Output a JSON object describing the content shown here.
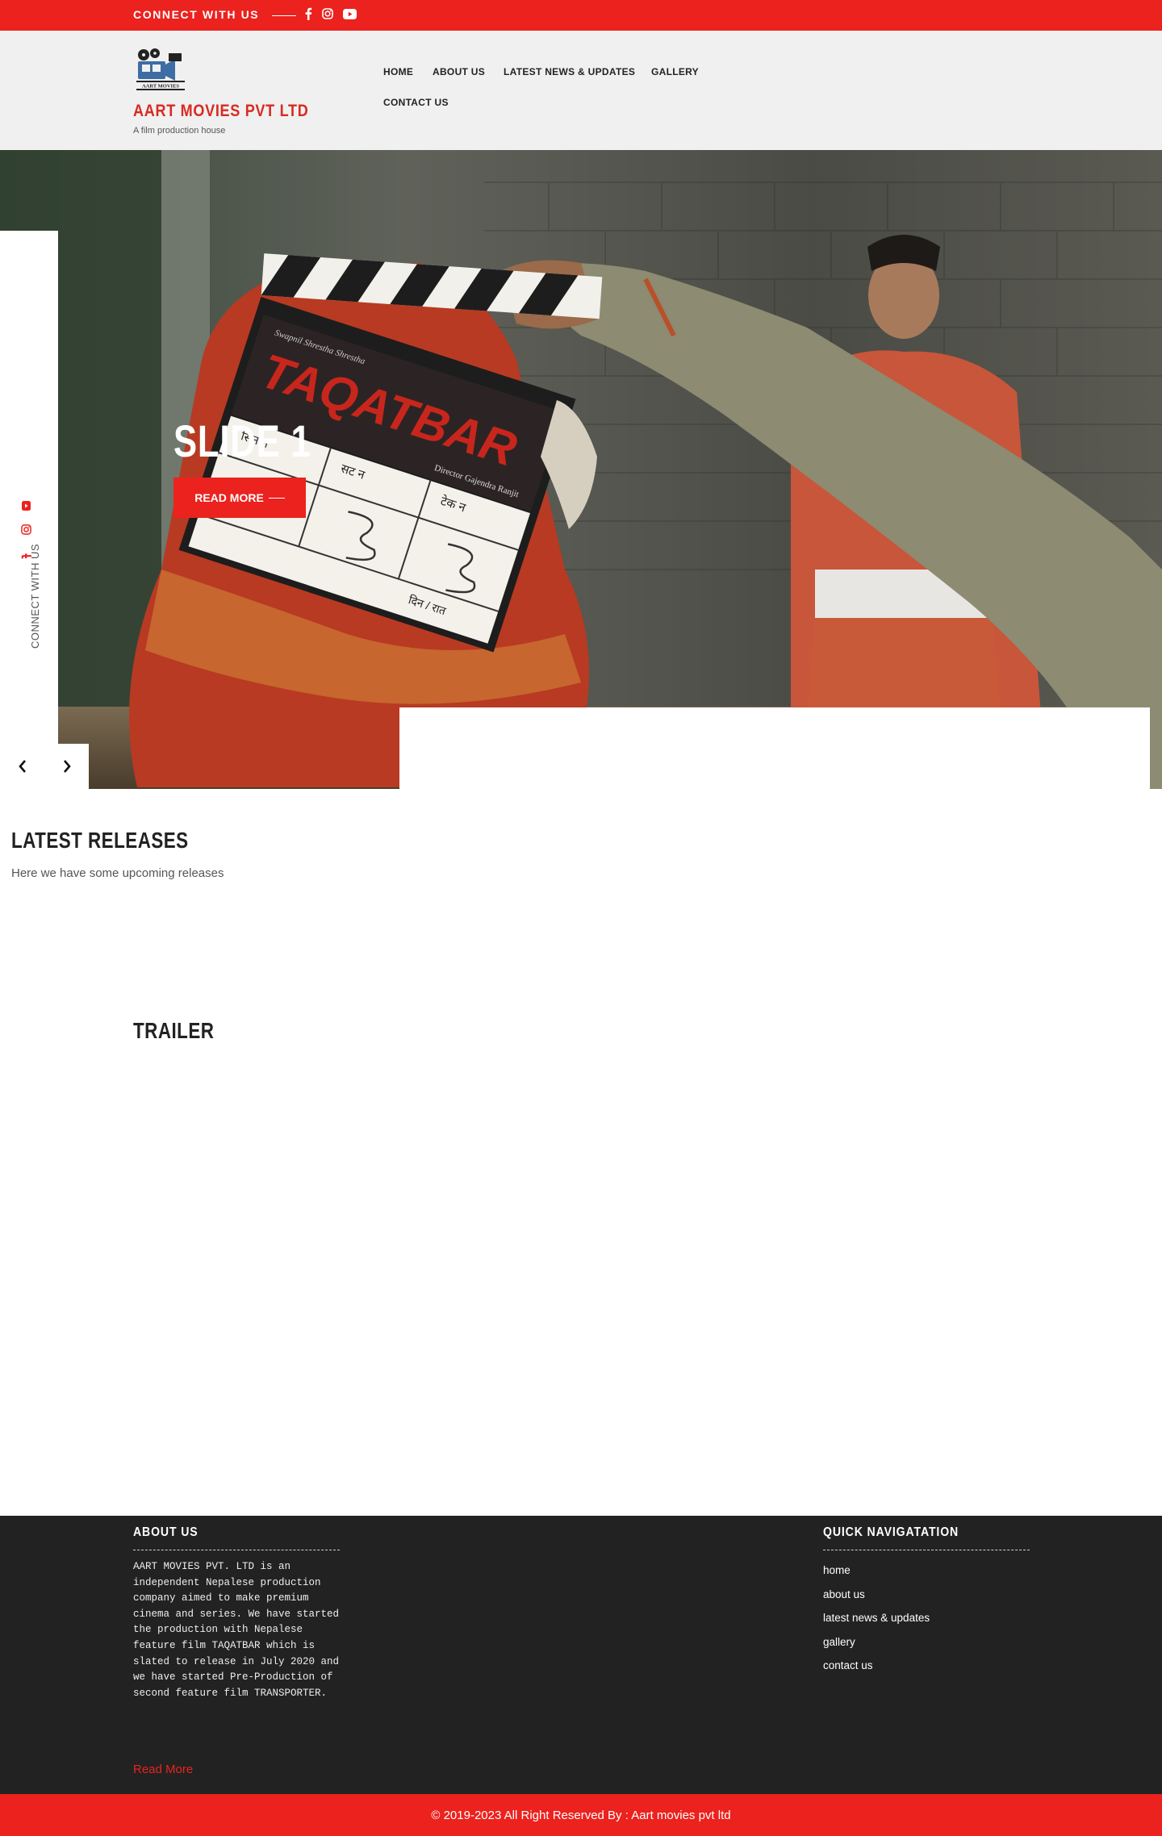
{
  "topbar": {
    "connect_label": "CONNECT WITH US",
    "social_icons": [
      "facebook-icon",
      "instagram-icon",
      "youtube-icon"
    ]
  },
  "header": {
    "brand": "AART MOVIES PVT LTD",
    "tagline": "A film production house",
    "logo_caption": "AART MOVIES",
    "nav": [
      "HOME",
      "ABOUT US",
      "LATEST NEWS & UPDATES",
      "GALLERY",
      "CONTACT US"
    ]
  },
  "hero": {
    "side_label": "CONNECT WITH US",
    "side_icons": [
      "youtube-icon",
      "instagram-icon",
      "facebook-icon"
    ],
    "slide_title": "SLIDE 1",
    "read_more": "READ MORE",
    "clapper": {
      "subtitle": "Swapnil Shrestha Shrestha",
      "film": "TAQATBAR",
      "director": "Director Gajendra Ranjit",
      "cells": [
        "सिन न",
        "सट न",
        "टेक न"
      ],
      "footer_cell": "दिन / रात"
    },
    "prev_arrow": "‹",
    "next_arrow": "›"
  },
  "latest": {
    "title": "LATEST RELEASES",
    "subtitle": "Here we have some upcoming releases"
  },
  "trailer": {
    "title": "TRAILER"
  },
  "footer": {
    "about_title": "ABOUT US",
    "about_text": "AART MOVIES PVT. LTD is an independent Nepalese production company aimed to make premium cinema and series. We have started the production with Nepalese feature film TAQATBAR which is slated to release in July 2020 and we have started Pre-Production of second feature film TRANSPORTER.",
    "read_more": "Read More",
    "nav_title": "QUICK NAVIGATATION",
    "nav_links": [
      "home",
      "about us",
      "latest news & updates",
      "gallery",
      "contact us"
    ]
  },
  "copyright": "© 2019-2023 All Right Reserved By : Aart movies pvt ltd",
  "colors": {
    "accent": "#eb221e",
    "header_bg": "#f0f0f0",
    "footer_bg": "#222222",
    "brand_text": "#d62b22"
  }
}
